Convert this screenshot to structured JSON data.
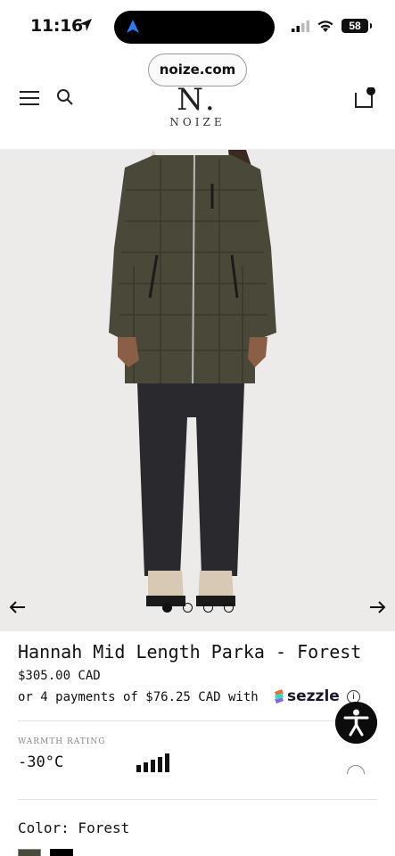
{
  "status_bar": {
    "time": "11:16",
    "battery": "58"
  },
  "browser": {
    "url": "noize.com"
  },
  "header": {
    "logo_mark": "N.",
    "logo_text": "NOIZE",
    "icons": [
      "menu-icon",
      "search-icon",
      "cart-icon"
    ]
  },
  "gallery": {
    "image_count": 4,
    "active_index": 0,
    "background_color": "#ecebea",
    "jacket_color": "#4a4839"
  },
  "product": {
    "title": "Hannah Mid Length Parka - Forest",
    "price": "$305.00 CAD",
    "installments_text": "or 4 payments of $76.25 CAD with",
    "sezzle_brand": "sezzle",
    "info_symbol": "i"
  },
  "warmth": {
    "label": "WARMTH RATING",
    "temperature": "-30°C",
    "level": 5,
    "max_level": 5
  },
  "color": {
    "label": "Color: Forest",
    "swatches": [
      {
        "name": "Forest",
        "hex": "#4a4a3c",
        "selected": true
      },
      {
        "name": "Black",
        "hex": "#000000",
        "selected": false
      }
    ]
  }
}
